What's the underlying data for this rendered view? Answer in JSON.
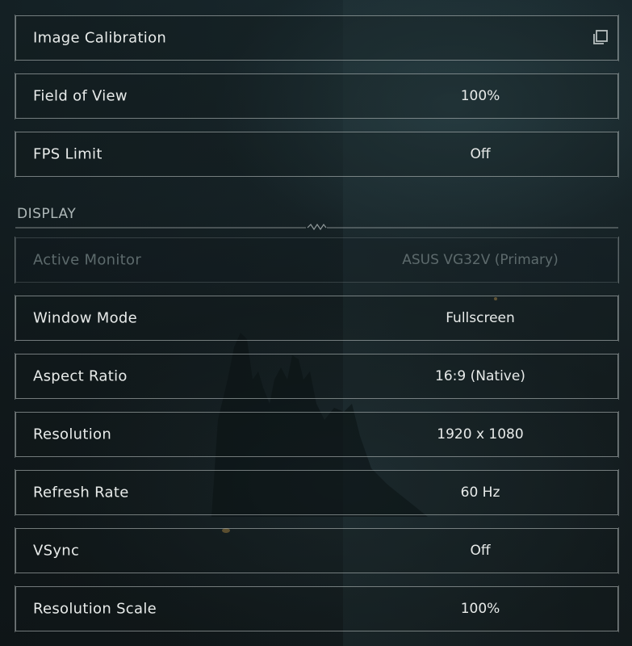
{
  "general": {
    "rows": [
      {
        "label": "Image Calibration",
        "value": "",
        "icon": "copy-icon"
      },
      {
        "label": "Field of View",
        "value": "100%"
      },
      {
        "label": "FPS Limit",
        "value": "Off"
      }
    ]
  },
  "display": {
    "header": "DISPLAY",
    "divider_icon": "ornament-icon",
    "rows": [
      {
        "label": "Active Monitor",
        "value": "ASUS VG32V (Primary)",
        "disabled": true
      },
      {
        "label": "Window Mode",
        "value": "Fullscreen"
      },
      {
        "label": "Aspect Ratio",
        "value": "16:9 (Native)"
      },
      {
        "label": "Resolution",
        "value": "1920 x 1080"
      },
      {
        "label": "Refresh Rate",
        "value": "60 Hz"
      },
      {
        "label": "VSync",
        "value": "Off"
      },
      {
        "label": "Resolution Scale",
        "value": "100%"
      }
    ]
  },
  "colors": {
    "text": "#e8ebea",
    "disabled_text": "#5d6a6c",
    "border": "#c4cccc",
    "background": "#162226"
  }
}
